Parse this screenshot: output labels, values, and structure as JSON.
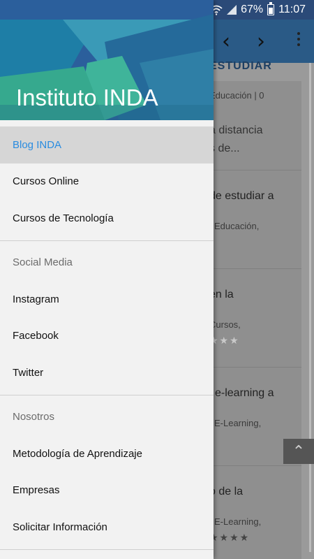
{
  "status_bar": {
    "battery": "67%",
    "time": "11:07"
  },
  "drawer": {
    "title": "Instituto INDA",
    "items": [
      {
        "label": "Blog INDA"
      },
      {
        "label": "Cursos Online"
      },
      {
        "label": "Cursos de Tecnología"
      }
    ],
    "social_section": "Social Media",
    "social_items": [
      {
        "label": "Instagram"
      },
      {
        "label": "Facebook"
      },
      {
        "label": "Twitter"
      }
    ],
    "about_section": "Nosotros",
    "about_items": [
      {
        "label": "Metodología de Aprendizaje"
      },
      {
        "label": "Empresas"
      },
      {
        "label": "Solicitar Información"
      }
    ]
  },
  "background": {
    "heading_fragment": "ESTUDIAR",
    "posts": [
      {
        "meta": "Educación | 0",
        "excerpt_1": "a distancia",
        "excerpt_2": "s de..."
      },
      {
        "title": "de estudiar a",
        "meta": "| Educación,"
      },
      {
        "title": "en la",
        "meta": "Cursos,",
        "stars": "★★★"
      },
      {
        "title": "l e-learning a",
        "meta": "| E-Learning,"
      },
      {
        "title": "o de la",
        "meta": "| E-Learning,",
        "stars": "★★★★"
      }
    ]
  }
}
